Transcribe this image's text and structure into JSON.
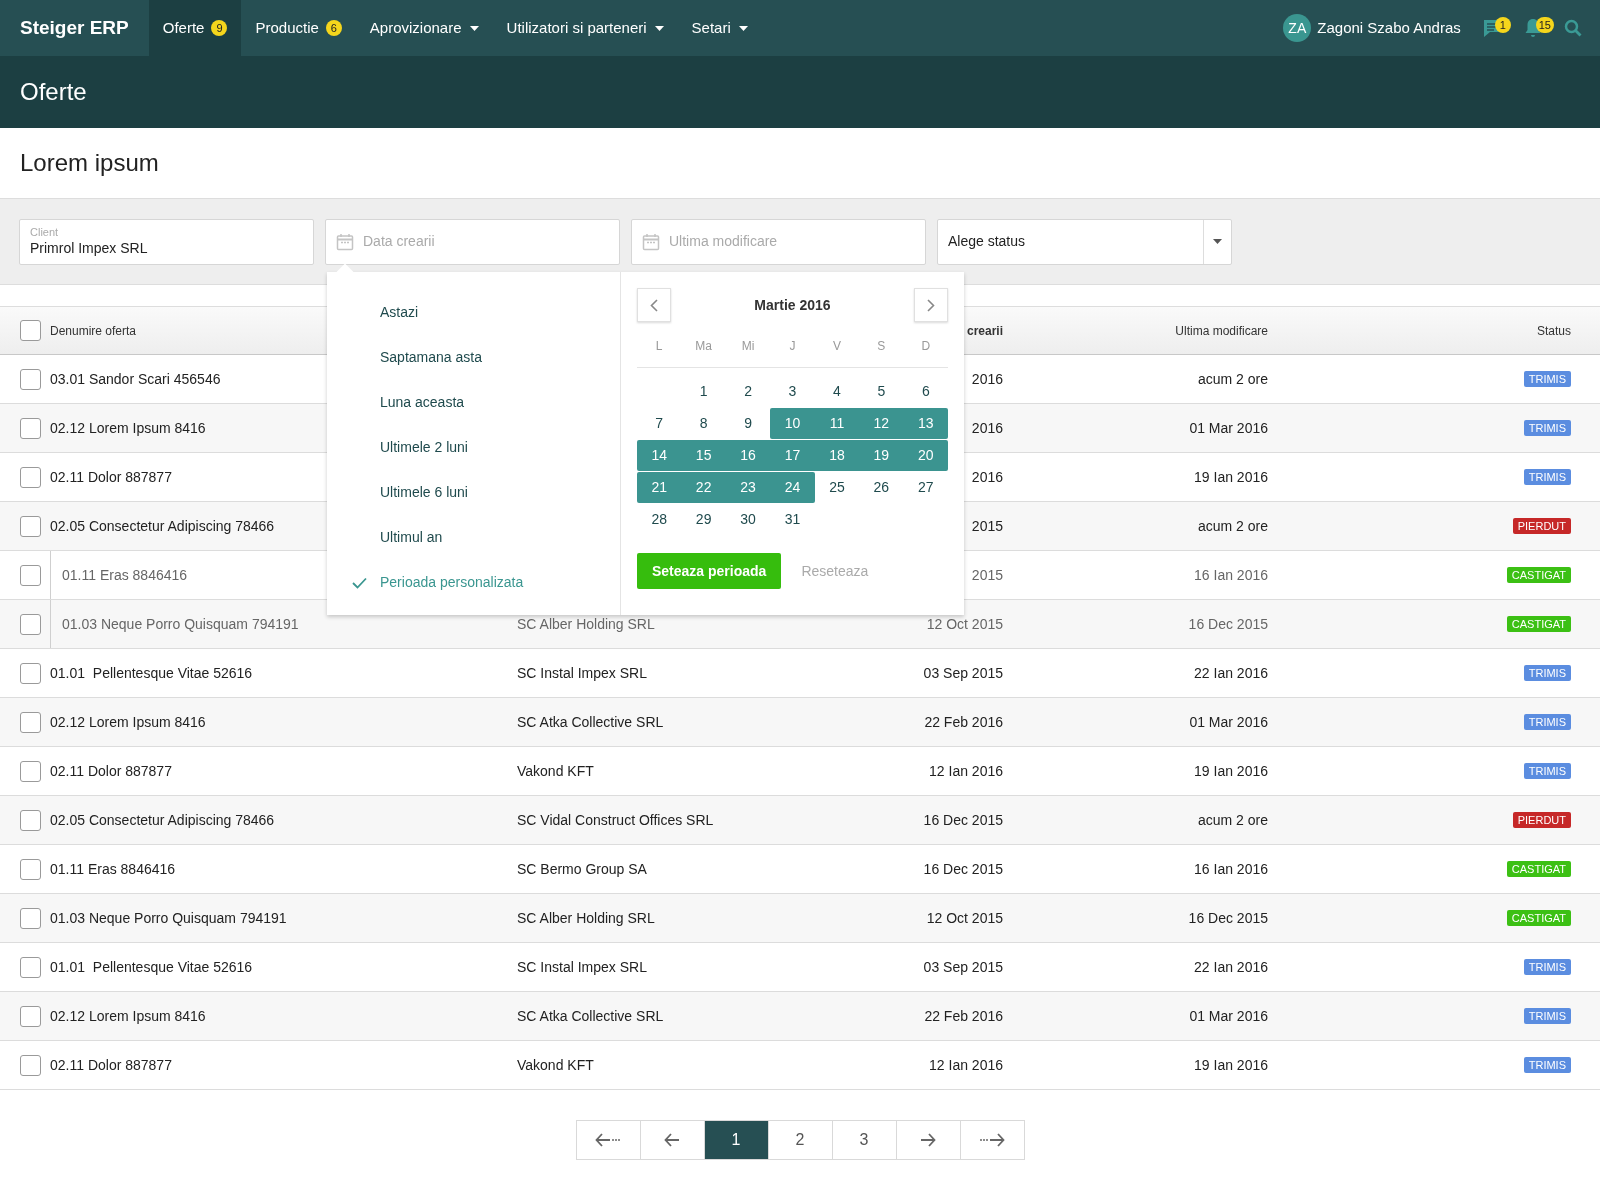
{
  "nav": {
    "brand": "Steiger ERP",
    "items": [
      {
        "label": "Oferte",
        "badge": "9",
        "dropdown": false,
        "selected": true
      },
      {
        "label": "Productie",
        "badge": "6",
        "dropdown": false,
        "selected": false
      },
      {
        "label": "Aprovizionare",
        "dropdown": true,
        "selected": false
      },
      {
        "label": "Utilizatori si parteneri",
        "dropdown": true,
        "selected": false
      },
      {
        "label": "Setari",
        "dropdown": true,
        "selected": false
      }
    ],
    "user": {
      "initials": "ZA",
      "name": "Zagoni Szabo Andras"
    },
    "messages_badge": "1",
    "notifications_badge": "15"
  },
  "page_title": "Oferte",
  "section_title": "Lorem ipsum",
  "filters": {
    "client": {
      "label": "Client",
      "value": "Primrol Impex SRL"
    },
    "date_created": {
      "placeholder": "Data crearii"
    },
    "last_modified": {
      "placeholder": "Ultima modificare"
    },
    "status": {
      "value": "Alege status"
    }
  },
  "date_popup": {
    "presets": [
      {
        "label": "Astazi",
        "selected": false
      },
      {
        "label": "Saptamana asta",
        "selected": false
      },
      {
        "label": "Luna aceasta",
        "selected": false
      },
      {
        "label": "Ultimele 2 luni",
        "selected": false
      },
      {
        "label": "Ultimele 6 luni",
        "selected": false
      },
      {
        "label": "Ultimul an",
        "selected": false
      },
      {
        "label": "Perioada personalizata",
        "selected": true
      }
    ],
    "calendar": {
      "month": "Martie 2016",
      "weekdays": [
        "L",
        "Ma",
        "Mi",
        "J",
        "V",
        "S",
        "D"
      ],
      "weeks": [
        [
          {
            "day": "1",
            "selected": false
          },
          {
            "day": "2",
            "selected": false
          },
          {
            "day": "3",
            "selected": false
          },
          {
            "day": "4",
            "selected": false
          },
          {
            "day": "5",
            "selected": false
          },
          {
            "day": "6",
            "selected": false
          }
        ],
        [
          {
            "day": "7",
            "selected": false
          },
          {
            "day": "8",
            "selected": false
          },
          {
            "day": "9",
            "selected": false
          },
          {
            "day": "10",
            "selected": true
          },
          {
            "day": "11",
            "selected": true
          },
          {
            "day": "12",
            "selected": true
          },
          {
            "day": "13",
            "selected": true
          }
        ],
        [
          {
            "day": "14",
            "selected": true
          },
          {
            "day": "15",
            "selected": true
          },
          {
            "day": "16",
            "selected": true
          },
          {
            "day": "17",
            "selected": true
          },
          {
            "day": "18",
            "selected": true
          },
          {
            "day": "19",
            "selected": true
          },
          {
            "day": "20",
            "selected": true
          }
        ],
        [
          {
            "day": "21",
            "selected": true
          },
          {
            "day": "22",
            "selected": true
          },
          {
            "day": "23",
            "selected": true
          },
          {
            "day": "24",
            "selected": true
          },
          {
            "day": "25",
            "selected": false
          },
          {
            "day": "26",
            "selected": false
          },
          {
            "day": "27",
            "selected": false
          }
        ],
        [
          {
            "day": "28",
            "selected": false
          },
          {
            "day": "29",
            "selected": false
          },
          {
            "day": "30",
            "selected": false
          },
          {
            "day": "31",
            "selected": false
          }
        ]
      ]
    },
    "apply_button": "Seteaza perioada",
    "reset_button": "Reseteaza"
  },
  "table": {
    "header_checked": false,
    "columns": {
      "name": "Denumire oferta",
      "created": "crearii",
      "modified": "Ultima modificare",
      "status": "Status"
    },
    "rows": [
      {
        "checked": false,
        "muted": false,
        "name": "03.01 Sandor Scari 456546",
        "created": "2016",
        "modified": "acum 2 ore",
        "status": {
          "label": "TRIMIS",
          "color": "#5b8de0"
        }
      },
      {
        "checked": false,
        "muted": false,
        "name": "02.12 Lorem Ipsum 8416",
        "created": "2016",
        "modified": "01 Mar 2016",
        "status": {
          "label": "TRIMIS",
          "color": "#5b8de0"
        }
      },
      {
        "checked": false,
        "muted": false,
        "name": "02.11 Dolor 887877",
        "created": "2016",
        "modified": "19 Ian 2016",
        "status": {
          "label": "TRIMIS",
          "color": "#5b8de0"
        }
      },
      {
        "checked": false,
        "muted": false,
        "name": "02.05 Consectetur Adipiscing 78466",
        "created": "2015",
        "modified": "acum 2 ore",
        "status": {
          "label": "PIERDUT",
          "color": "#c62828"
        }
      },
      {
        "checked": false,
        "muted": true,
        "name": "01.11 Eras 8846416",
        "created": "2015",
        "modified": "16 Ian 2016",
        "status": {
          "label": "CASTIGAT",
          "color": "#3cc014"
        }
      },
      {
        "checked": false,
        "muted": true,
        "name": "01.03 Neque Porro Quisquam 794191",
        "client": "SC Alber Holding SRL",
        "created": "12 Oct 2015",
        "modified": "16 Dec 2015",
        "status": {
          "label": "CASTIGAT",
          "color": "#3cc014"
        }
      },
      {
        "checked": false,
        "muted": false,
        "name": "01.01  Pellentesque Vitae 52616",
        "client": "SC Instal Impex SRL",
        "created": "03 Sep 2015",
        "modified": "22 Ian 2016",
        "status": {
          "label": "TRIMIS",
          "color": "#5b8de0"
        }
      },
      {
        "checked": false,
        "muted": false,
        "name": "02.12 Lorem Ipsum 8416",
        "client": "SC Atka Collective SRL",
        "created": "22 Feb 2016",
        "modified": "01 Mar 2016",
        "status": {
          "label": "TRIMIS",
          "color": "#5b8de0"
        }
      },
      {
        "checked": false,
        "muted": false,
        "name": "02.11 Dolor 887877",
        "client": "Vakond KFT",
        "created": "12 Ian 2016",
        "modified": "19 Ian 2016",
        "status": {
          "label": "TRIMIS",
          "color": "#5b8de0"
        }
      },
      {
        "checked": false,
        "muted": false,
        "name": "02.05 Consectetur Adipiscing 78466",
        "client": "SC Vidal Construct Offices SRL",
        "created": "16 Dec 2015",
        "modified": "acum 2 ore",
        "status": {
          "label": "PIERDUT",
          "color": "#c62828"
        }
      },
      {
        "checked": false,
        "muted": false,
        "name": "01.11 Eras 8846416",
        "client": "SC Bermo Group SA",
        "created": "16 Dec 2015",
        "modified": "16 Ian 2016",
        "status": {
          "label": "CASTIGAT",
          "color": "#3cc014"
        }
      },
      {
        "checked": false,
        "muted": false,
        "name": "01.03 Neque Porro Quisquam 794191",
        "client": "SC Alber Holding SRL",
        "created": "12 Oct 2015",
        "modified": "16 Dec 2015",
        "status": {
          "label": "CASTIGAT",
          "color": "#3cc014"
        }
      },
      {
        "checked": false,
        "muted": false,
        "name": "01.01  Pellentesque Vitae 52616",
        "client": "SC Instal Impex SRL",
        "created": "03 Sep 2015",
        "modified": "22 Ian 2016",
        "status": {
          "label": "TRIMIS",
          "color": "#5b8de0"
        }
      },
      {
        "checked": false,
        "muted": false,
        "name": "02.12 Lorem Ipsum 8416",
        "client": "SC Atka Collective SRL",
        "created": "22 Feb 2016",
        "modified": "01 Mar 2016",
        "status": {
          "label": "TRIMIS",
          "color": "#5b8de0"
        }
      },
      {
        "checked": false,
        "muted": false,
        "name": "02.11 Dolor 887877",
        "client": "Vakond KFT",
        "created": "12 Ian 2016",
        "modified": "19 Ian 2016",
        "status": {
          "label": "TRIMIS",
          "color": "#5b8de0"
        }
      }
    ]
  },
  "pagination": [
    {
      "kind": "first",
      "selected": false
    },
    {
      "kind": "prev",
      "selected": false
    },
    {
      "kind": "page",
      "label": "1",
      "selected": true
    },
    {
      "kind": "page",
      "label": "2",
      "selected": false
    },
    {
      "kind": "page",
      "label": "3",
      "selected": false
    },
    {
      "kind": "next",
      "selected": false
    },
    {
      "kind": "last",
      "selected": false
    }
  ]
}
